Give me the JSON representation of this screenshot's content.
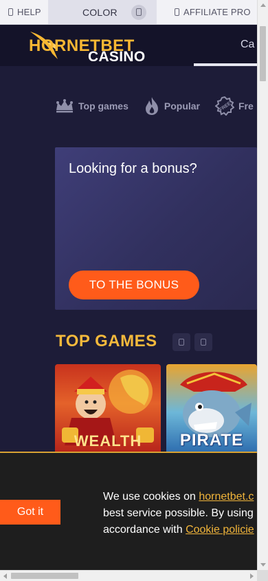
{
  "utility_bar": {
    "help_label": "HELP",
    "color_label": "COLOR",
    "affiliate_label": "AFFILIATE PRO"
  },
  "header": {
    "logo_text": "HORNETBET",
    "logo_subtext": "CASINO",
    "nav_partial": "Ca"
  },
  "category_tabs": [
    {
      "label": "Top games",
      "icon": "crown-icon"
    },
    {
      "label": "Popular",
      "icon": "flame-icon"
    },
    {
      "label": "Fre",
      "icon": "free-badge-icon"
    }
  ],
  "bonus_banner": {
    "title": "Looking for a bonus?",
    "button_label": "TO THE BONUS"
  },
  "top_games": {
    "title": "TOP GAMES",
    "cards": [
      {
        "label": "WEALTH"
      },
      {
        "label": "PIRATE"
      }
    ]
  },
  "cookie_banner": {
    "button_label": "Got it",
    "line1_prefix": "We use cookies on ",
    "line1_link": "hornetbet.c",
    "line2": "best service possible. By using",
    "line3_prefix": "accordance with ",
    "line3_link": "Cookie policie"
  },
  "colors": {
    "accent": "#ff5b1a",
    "gold": "#f4b93c",
    "background": "#1d1c38"
  }
}
